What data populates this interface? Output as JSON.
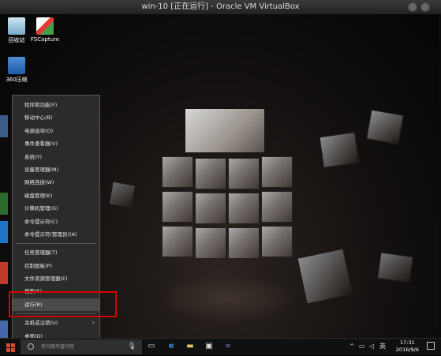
{
  "window": {
    "title": "win-10 [正在运行] - Oracle VM VirtualBox"
  },
  "desktop": {
    "icons": [
      {
        "label": "回收站",
        "icon": "recycle-bin-icon"
      },
      {
        "label": "FSCapture",
        "icon": "fscapture-icon"
      },
      {
        "label": "360压缩",
        "icon": "archive-icon"
      }
    ]
  },
  "menu": {
    "items": [
      {
        "label": "程序和功能(F)"
      },
      {
        "label": "移动中心(B)"
      },
      {
        "label": "电源选项(O)"
      },
      {
        "label": "事件查看器(V)"
      },
      {
        "label": "系统(Y)"
      },
      {
        "label": "设备管理器(M)"
      },
      {
        "label": "网络连接(W)"
      },
      {
        "label": "磁盘管理(K)"
      },
      {
        "label": "计算机管理(G)"
      },
      {
        "label": "命令提示符(C)"
      },
      {
        "label": "命令提示符(管理员)(A)"
      },
      {
        "label": "任务管理器(T)"
      },
      {
        "label": "控制面板(P)"
      },
      {
        "label": "文件资源管理器(E)"
      },
      {
        "label": "搜索(S)"
      },
      {
        "label": "运行(R)"
      },
      {
        "label": "关机或注销(U)"
      },
      {
        "label": "桌面(D)"
      }
    ]
  },
  "taskbar": {
    "search_placeholder": "有问题尽管问我",
    "clock_time": "17:31",
    "clock_date": "2016/9/6",
    "ime": "英"
  },
  "colors": {
    "highlight_box": "#d40000",
    "start_logo": "#d84a2a"
  }
}
